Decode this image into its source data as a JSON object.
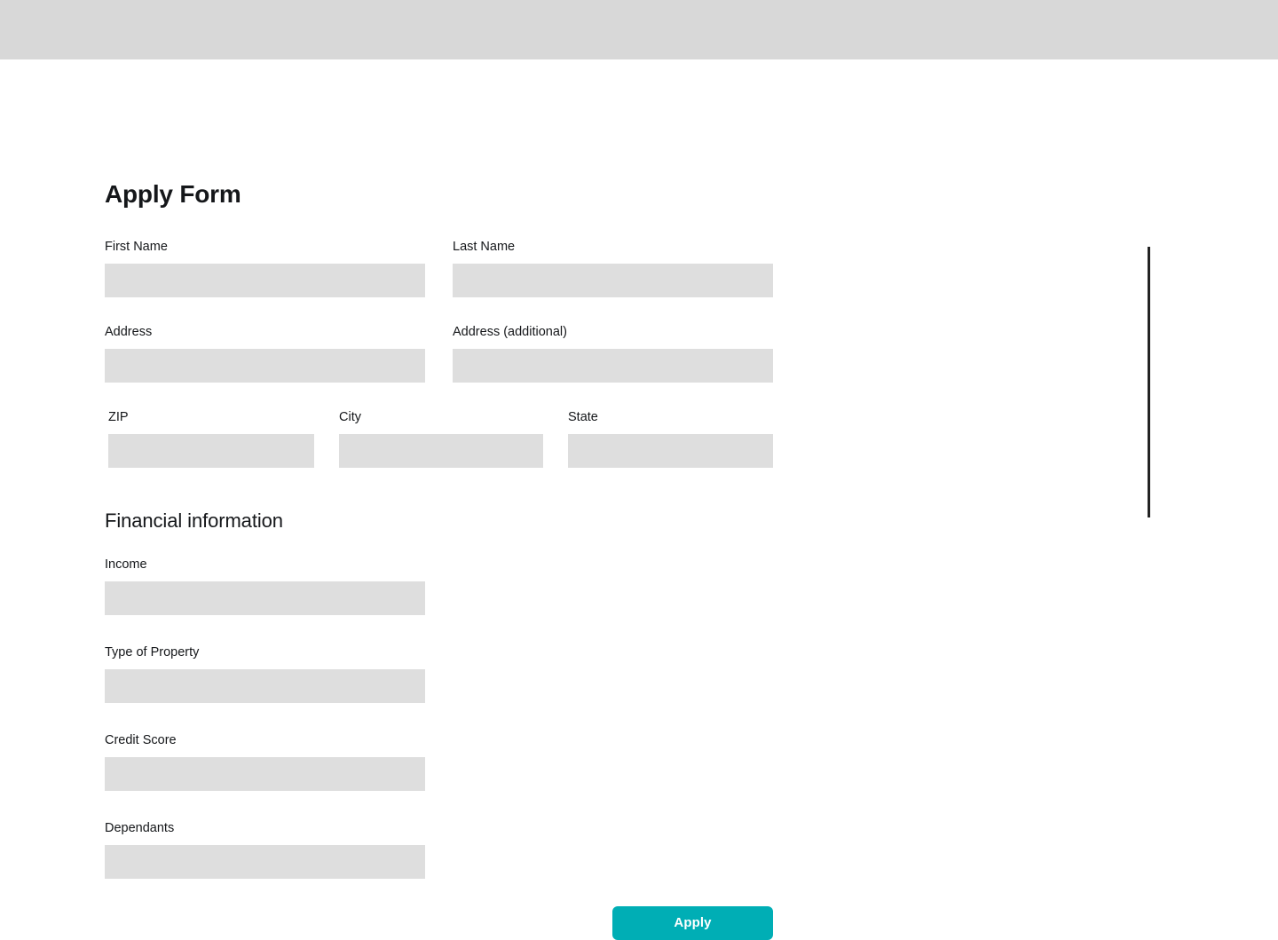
{
  "window": {
    "top_bar_color": "#d8d8d8"
  },
  "form": {
    "title": "Apply Form",
    "personal_fields": [
      {
        "label": "First Name",
        "value": "",
        "placeholder": ""
      },
      {
        "label": "Last Name",
        "value": "",
        "placeholder": ""
      },
      {
        "label": "Address",
        "value": "",
        "placeholder": ""
      },
      {
        "label": "Address (additional)",
        "value": "",
        "placeholder": ""
      },
      {
        "label": "ZIP",
        "value": "",
        "placeholder": ""
      },
      {
        "label": "City",
        "value": "",
        "placeholder": ""
      },
      {
        "label": "State",
        "value": "",
        "placeholder": ""
      }
    ],
    "financial_section": {
      "title": "Financial information",
      "fields": [
        {
          "label": "Income",
          "value": "",
          "placeholder": ""
        },
        {
          "label": "Type of Property",
          "value": "",
          "placeholder": ""
        },
        {
          "label": "Credit Score",
          "value": "",
          "placeholder": ""
        },
        {
          "label": "Dependants",
          "value": "",
          "placeholder": ""
        }
      ]
    },
    "submit": {
      "label": "Apply",
      "color": "#00aeb5",
      "text_color": "#ffffff"
    }
  },
  "decor": {
    "vertical_rule_color": "#232323"
  }
}
